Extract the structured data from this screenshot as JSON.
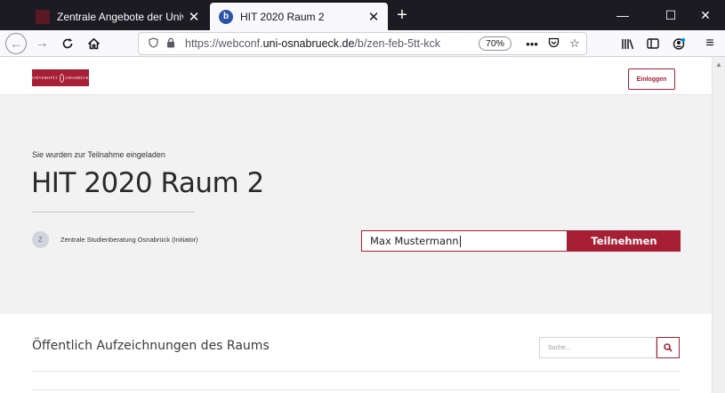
{
  "browser": {
    "tabs": [
      {
        "title": "Zentrale Angebote der Universit",
        "active": false
      },
      {
        "title": "HIT 2020 Raum 2",
        "active": true
      }
    ],
    "favicon_letter": "b",
    "url_prefix": "https://webconf.",
    "url_domain": "uni-osnabrueck.de",
    "url_path": "/b/zen-feb-5tt-kck",
    "zoom": "70%"
  },
  "site": {
    "login_label": "Einloggen"
  },
  "room": {
    "invite_text": "Sie wurden zur Teilnahme eingeladen",
    "title": "HIT 2020 Raum 2",
    "owner_initial": "Z",
    "owner": "Zentrale Studienberatung Osnabrück (Initiator)",
    "name_value": "Max Mustermann",
    "join_label": "Teilnehmen"
  },
  "recordings": {
    "title": "Öffentlich Aufzeichnungen des Raums",
    "search_placeholder": "Suche..."
  },
  "colors": {
    "brand": "#a71f35",
    "tabstrip": "#1c1b22"
  }
}
